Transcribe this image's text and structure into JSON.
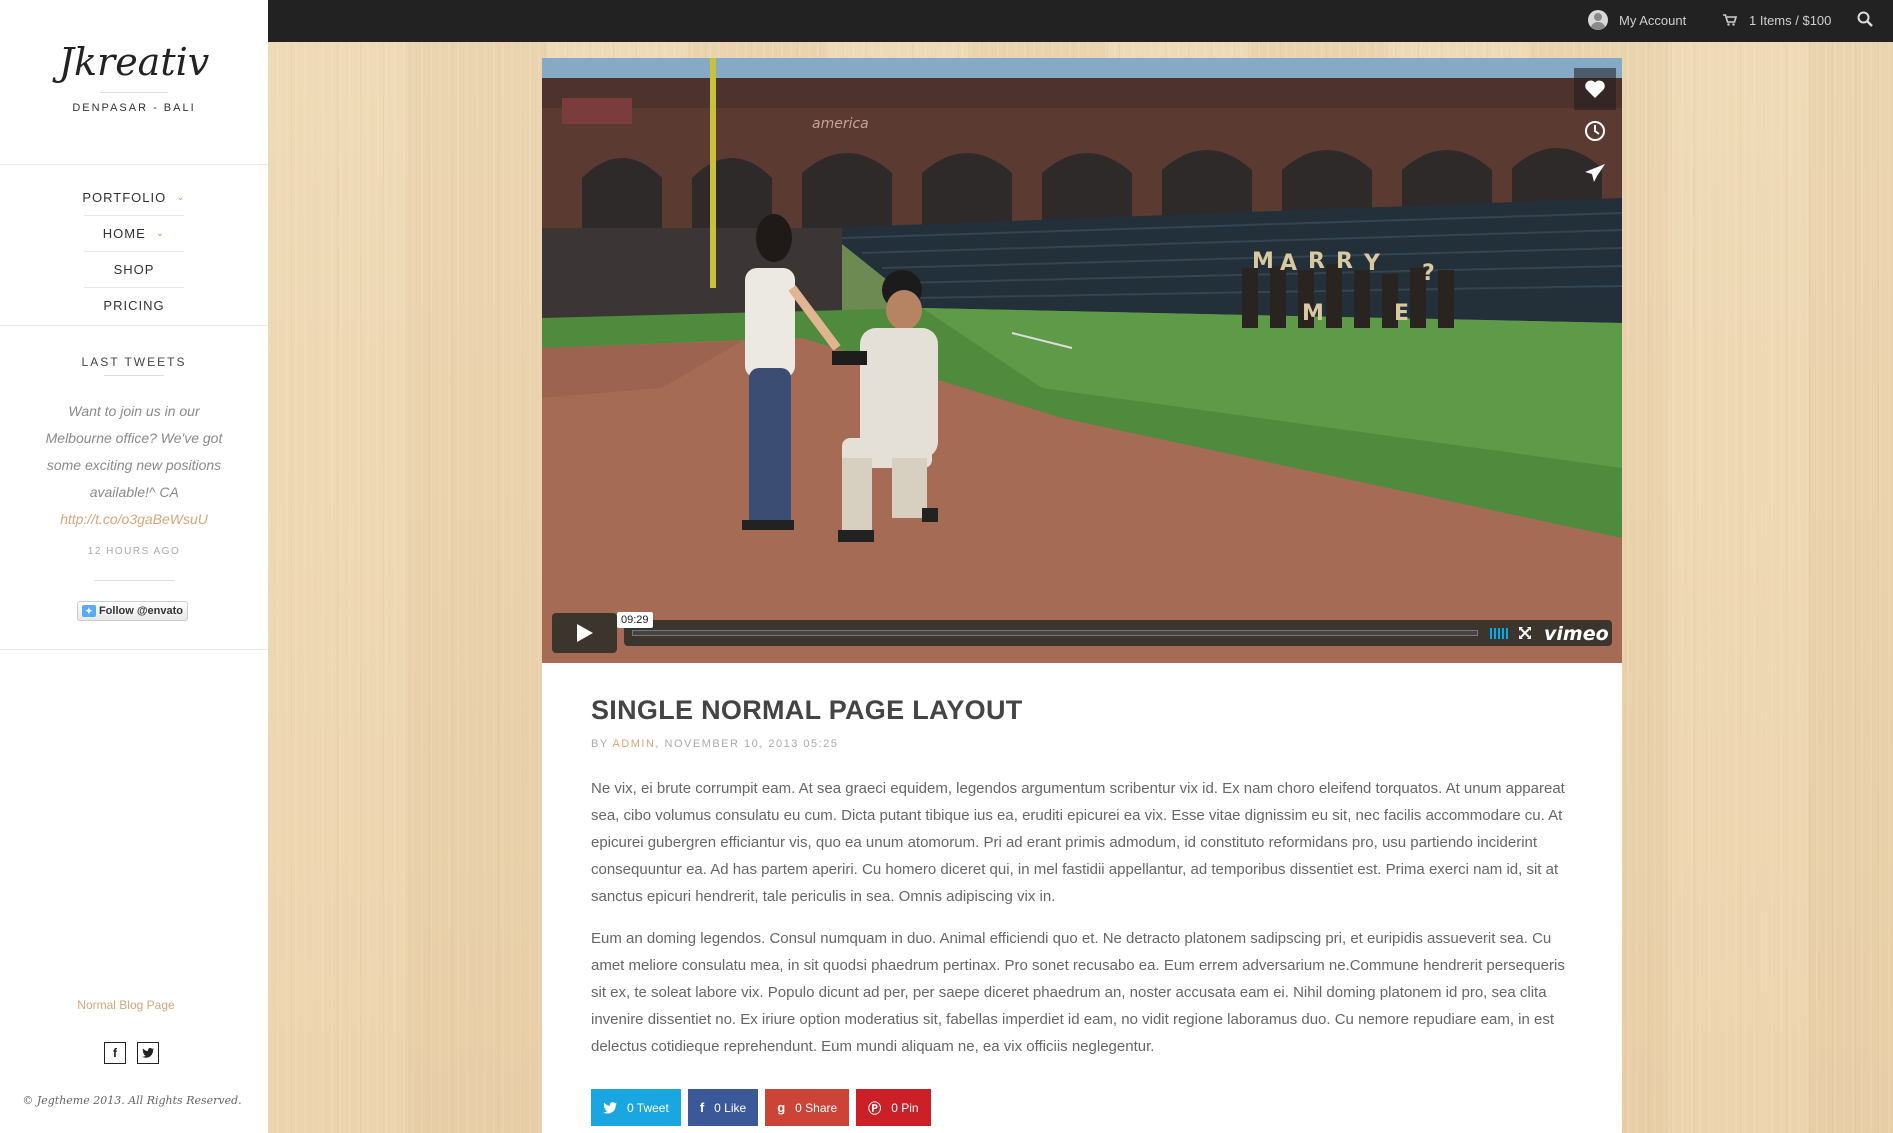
{
  "sidebar": {
    "logo": "Jkreativ",
    "tagline": "DENPASAR - BALI",
    "nav": [
      {
        "label": "PORTFOLIO",
        "has_submenu": true
      },
      {
        "label": "HOME",
        "has_submenu": true
      },
      {
        "label": "SHOP",
        "has_submenu": false
      },
      {
        "label": "PRICING",
        "has_submenu": false
      }
    ],
    "widget_title": "LAST TWEETS",
    "tweet": {
      "text": "Want to join us in our Melbourne office? We've got some exciting new positions available!^ CA",
      "link_text": "http://t.co/o3gaBeWsuU",
      "time": "12 HOURS AGO"
    },
    "follow_button": "Follow @envato",
    "blog_link": "Normal Blog Page",
    "social_icons": [
      "facebook-icon",
      "twitter-icon"
    ],
    "copyright": "© Jegtheme 2013. All Rights Reserved."
  },
  "topbar": {
    "account_label": "My Account",
    "cart_label": "1 Items / $100",
    "icons": [
      "avatar-icon",
      "cart-icon",
      "search-icon"
    ]
  },
  "video": {
    "time": "09:29",
    "brand": "vimeo",
    "side_icons": [
      "heart-icon",
      "clock-icon",
      "send-icon"
    ]
  },
  "post": {
    "title": "SINGLE NORMAL PAGE LAYOUT",
    "meta_by": "BY",
    "meta_author": "ADMIN",
    "meta_date": ", NOVEMBER 10, 2013 05:25",
    "paragraphs": [
      "Ne vix, ei brute corrumpit eam. At sea graeci equidem, legendos argumentum scribentur vix id. Ex nam choro eleifend torquatos. At unum appareat sea, cibo volumus consulatu eu cum. Dicta putant tibique ius ea, eruditi epicurei ea vix. Esse vitae dignissim eu sit, nec facilis accommodare cu. At epicurei gubergren efficiantur vis, quo ea unum atomorum. Pri ad erant primis admodum, id constituto reformidans pro, usu partiendo inciderint consequuntur ea. Ad has partem aperiri. Cu homero diceret qui, in mel fastidii appellantur, ad temporibus dissentiet est. Prima exerci nam id, sit at sanctus epicuri hendrerit, tale periculis in sea. Omnis adipiscing vix in.",
      "Eum an doming legendos. Consul numquam in duo. Animal efficiendi quo et. Ne detracto platonem sadipscing pri, et euripidis assueverit sea. Cu amet meliore consulatu mea, in sit quodsi phaedrum pertinax. Pro sonet recusabo ea. Eum errem adversarium ne.Commune hendrerit persequeris sit ex, te soleat labore vix. Populo dicunt ad per, per saepe diceret phaedrum an, noster accusata eam ei. Nihil doming platonem id pro, sea clita invenire dissentiet no. Ex iriure option moderatius sit, fabellas imperdiet id eam, no vidit regione laboramus duo. Cu nemore repudiare eam, in est delectus cotidieque reprehendunt. Eum mundi aliquam ne, ea vix officiis neglegentur."
    ],
    "share": [
      {
        "label": "0 Tweet",
        "icon": "twitter-icon",
        "color": "#1aa7e1"
      },
      {
        "label": "0 Like",
        "icon": "facebook-icon",
        "color": "#3b5998"
      },
      {
        "label": "0 Share",
        "icon": "google-plus-icon",
        "color": "#cb4437"
      },
      {
        "label": "0 Pin",
        "icon": "pinterest-icon",
        "color": "#cb2027"
      }
    ]
  },
  "colors": {
    "accent": "#d4a77a",
    "topbar": "#222222",
    "vimeo_blue": "#00adef"
  }
}
